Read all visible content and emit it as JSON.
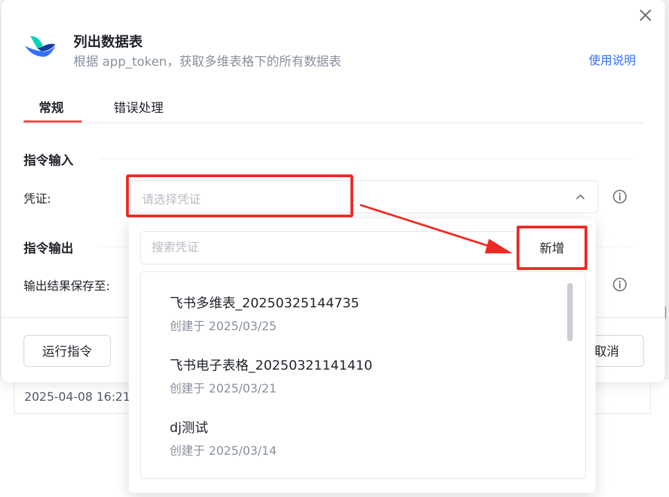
{
  "dialog": {
    "title": "列出数据表",
    "subtitle": "根据 app_token，获取多维表格下的所有数据表",
    "help_link": "使用说明",
    "logo_icon": "feishu-bitable-logo",
    "close_icon": "close-icon"
  },
  "tabs": [
    {
      "label": "常规",
      "active": true
    },
    {
      "label": "错误处理",
      "active": false
    }
  ],
  "input_section": {
    "title": "指令输入",
    "credential_label": "凭证:",
    "credential_placeholder": "请选择凭证"
  },
  "output_section": {
    "title": "指令输出",
    "save_label": "输出结果保存至:"
  },
  "footer": {
    "run_button": "运行指令",
    "cancel_button": "取消"
  },
  "dropdown": {
    "search_placeholder": "搜索凭证",
    "add_button": "新增",
    "items": [
      {
        "name": "飞书多维表_20250325144735",
        "created": "创建于 2025/03/25"
      },
      {
        "name": "飞书电子表格_20250321141410",
        "created": "创建于 2025/03/21"
      },
      {
        "name": "dj测试",
        "created": "创建于 2025/03/14"
      }
    ]
  },
  "background": {
    "row_timestamp": "2025-04-08 16:21"
  },
  "colors": {
    "accent_blue": "#3370ff",
    "tab_underline": "#f54a45",
    "annotation_red": "#ee2a24"
  }
}
